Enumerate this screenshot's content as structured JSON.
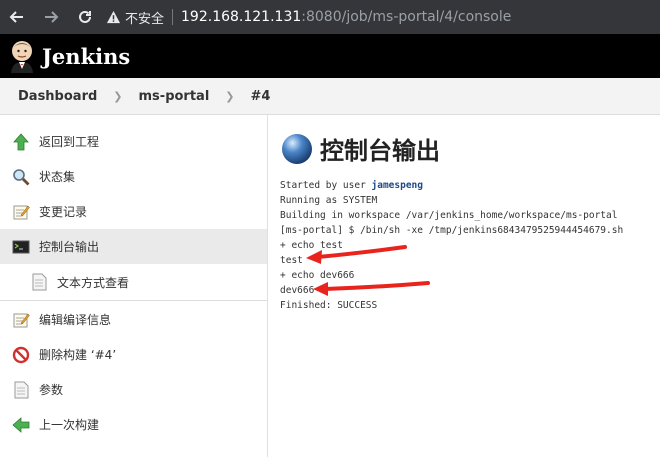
{
  "browser": {
    "security_label": "不安全",
    "url_host": "192.168.121.131",
    "url_path": ":8080/job/ms-portal/4/console"
  },
  "header": {
    "brand": "Jenkins"
  },
  "breadcrumbs": [
    "Dashboard",
    "ms-portal",
    "#4"
  ],
  "sidebar": {
    "items": [
      {
        "label": "返回到工程",
        "icon": "up-arrow-icon"
      },
      {
        "label": "状态集",
        "icon": "magnifier-icon"
      },
      {
        "label": "变更记录",
        "icon": "notepad-icon"
      },
      {
        "label": "控制台输出",
        "icon": "terminal-icon"
      },
      {
        "label": "文本方式查看",
        "icon": "document-icon"
      },
      {
        "label": "编辑编译信息",
        "icon": "notepad-icon"
      },
      {
        "label": "删除构建 ‘#4’",
        "icon": "no-entry-icon"
      },
      {
        "label": "参数",
        "icon": "document-icon"
      },
      {
        "label": "上一次构建",
        "icon": "left-arrow-icon"
      }
    ]
  },
  "main": {
    "title": "控制台输出",
    "console": {
      "started_prefix": "Started by user ",
      "started_user": "jamespeng",
      "lines": [
        "Running as SYSTEM",
        "Building in workspace /var/jenkins_home/workspace/ms-portal",
        "[ms-portal] $ /bin/sh -xe /tmp/jenkins6843479525944454679.sh",
        "+ echo test",
        "test",
        "+ echo dev666",
        "dev666",
        "Finished: SUCCESS"
      ]
    }
  },
  "colors": {
    "annotation_arrow": "#e8241c",
    "header_bg": "#000000"
  }
}
